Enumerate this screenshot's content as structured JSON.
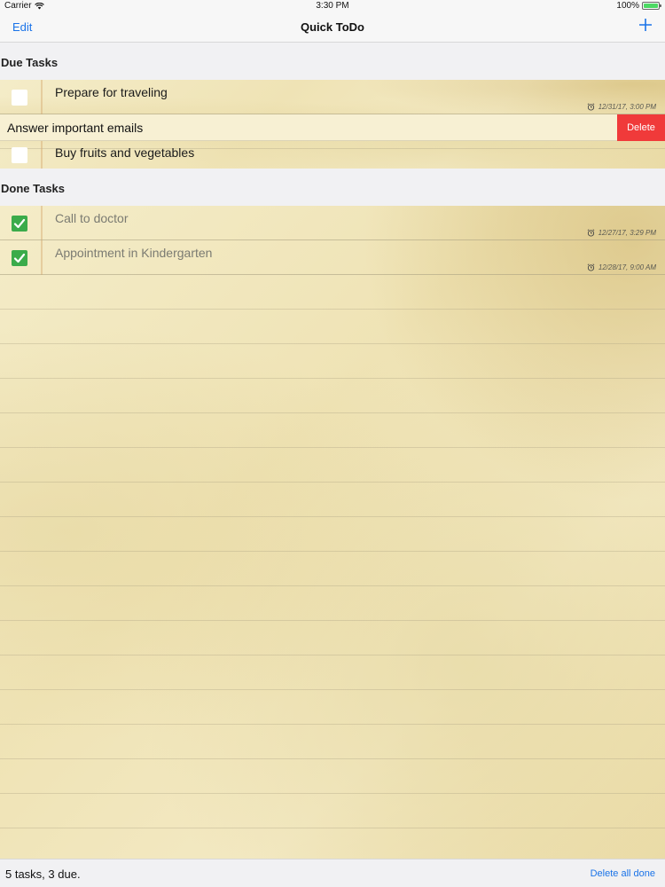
{
  "status_bar": {
    "carrier": "Carrier",
    "time": "3:30 PM",
    "battery": "100%",
    "battery_level": 1.0
  },
  "nav": {
    "edit_label": "Edit",
    "title": "Quick ToDo",
    "add_icon": "plus-icon"
  },
  "sections": {
    "due_title": "Due Tasks",
    "done_title": "Done Tasks"
  },
  "due_tasks": [
    {
      "title": "Prepare for traveling",
      "checked": false,
      "due": "12/31/17, 3:00 PM"
    },
    {
      "title": "Answer important emails",
      "checked": false,
      "swiped": true,
      "action": "Delete"
    },
    {
      "title": "Buy fruits and vegetables",
      "checked": false
    }
  ],
  "done_tasks": [
    {
      "title": "Call to doctor",
      "checked": true,
      "due": "12/27/17, 3:29 PM"
    },
    {
      "title": "Appointment in Kindergarten",
      "checked": true,
      "due": "12/28/17, 9:00 AM"
    }
  ],
  "toolbar": {
    "summary": "5 tasks, 3 due.",
    "delete_all_label": "Delete all done"
  },
  "colors": {
    "accent": "#1a73e8",
    "delete": "#f03a3a",
    "check": "#3bab4a",
    "paper": "#f2e8c2"
  }
}
